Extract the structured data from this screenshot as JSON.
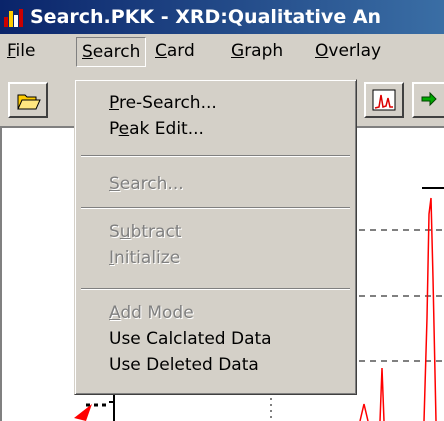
{
  "window": {
    "title": "Search.PKK - XRD:Qualitative An"
  },
  "menubar": {
    "items": [
      {
        "underline": "F",
        "rest": "ile"
      },
      {
        "underline": "S",
        "rest": "earch"
      },
      {
        "pre": "",
        "underline": "C",
        "rest": "ard"
      },
      {
        "underline": "G",
        "rest": "raph"
      },
      {
        "underline": "O",
        "rest": "verlay"
      }
    ]
  },
  "toolbar": {
    "buttons": [
      "open-folder-icon",
      "peak-graph-icon",
      "green-arrows-icon"
    ]
  },
  "search_menu": {
    "pre_search": {
      "pre": "",
      "underline": "P",
      "rest": "re-Search..."
    },
    "peak_edit": {
      "pre": "P",
      "underline": "e",
      "rest": "ak Edit..."
    },
    "search": {
      "pre": "",
      "underline": "S",
      "rest": "earch..."
    },
    "subtract": {
      "pre": "S",
      "underline": "u",
      "rest": "btract"
    },
    "initialize": {
      "pre": "",
      "underline": "I",
      "rest": "nitialize"
    },
    "add_mode": {
      "pre": "",
      "underline": "A",
      "rest": "dd Mode"
    },
    "use_calculated": "Use Calclated Data",
    "use_deleted": "Use Deleted Data"
  },
  "colors": {
    "title_bar": "#0a246a",
    "menu_bg": "#d4d0c8",
    "disabled_text": "#808080",
    "spectrum_line": "#ff0000",
    "pointer": "#ff0000"
  }
}
